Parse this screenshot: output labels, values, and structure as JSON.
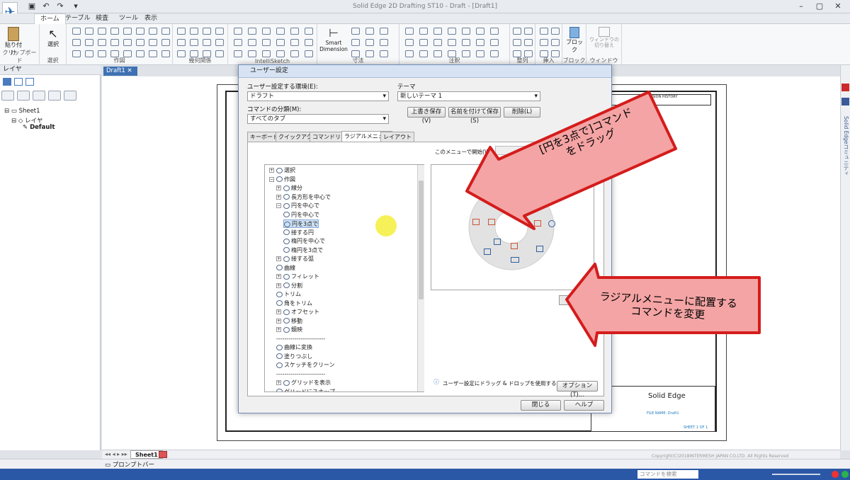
{
  "app": {
    "title": "Solid Edge 2D Drafting ST10 - Draft - [Draft1]",
    "menu_glyph": "▾",
    "tabs": [
      "ホーム",
      "テーブル",
      "検査",
      "ツール",
      "表示"
    ]
  },
  "ribbon": {
    "groups": [
      "クリップボード",
      "選択",
      "作図",
      "幾何関係",
      "IntelliSketch",
      "寸法",
      "注釈",
      "整列",
      "挿入",
      "ブロック",
      "ウィンドウ"
    ],
    "paste_label": "貼り付け",
    "select_label": "選択",
    "smart_dimension_label": "Smart Dimension",
    "block_label": "ブロック",
    "window_label": "ウィンドウの切り替え"
  },
  "left_panel": {
    "title": "レイヤ",
    "tree": [
      "Sheet1",
      "レイヤ",
      "Default"
    ]
  },
  "document": {
    "tab": "Draft1"
  },
  "sheet_tab": "Sheet1",
  "status": {
    "prompt_bar": "プロンプトバー",
    "copyright": "Copyright(C)2018INTERMESH JAPAN CO.LTD. All Rights Reserved",
    "command_search": "コマンドを検索"
  },
  "title_block": {
    "brand": "Solid Edge",
    "file_name": "FILE NAME: Draft1",
    "sheet": "SHEET 1 OF 1",
    "revision_history": "REVISION HISTORY"
  },
  "side_links": [
    "Solid Edgeコミュニティ"
  ],
  "dialog": {
    "title": "ユーザー設定",
    "env_label": "ユーザー設定する環境(E):",
    "env_value": "ドラフト",
    "theme_label": "テーマ",
    "theme_value": "新しいテーマ 1",
    "category_label": "コマンドの分類(M):",
    "category_value": "すべてのタブ",
    "overwrite_button": "上書き保存(V)",
    "saveas_button": "名前を付けて保存(S)",
    "delete_button": "削除(L)",
    "tabs": [
      "キーボード",
      "クイックアクセス",
      "コマンドリボン",
      "ラジアルメニュー",
      "レイアウト"
    ],
    "active_tab": "ラジアルメニュー",
    "start_menu_label": "このメニューで開始(W):",
    "tree_items": [
      {
        "label": "選択",
        "level": 0,
        "expand": "+"
      },
      {
        "label": "作図",
        "level": 0,
        "expand": "−"
      },
      {
        "label": "線分",
        "level": 1,
        "expand": "+"
      },
      {
        "label": "長方形を中心で",
        "level": 1,
        "expand": "+"
      },
      {
        "label": "円を中心で",
        "level": 1,
        "expand": "−"
      },
      {
        "label": "円を中心で",
        "level": 2,
        "expand": ""
      },
      {
        "label": "円を3点で",
        "level": 2,
        "expand": "",
        "selected": true
      },
      {
        "label": "接する円",
        "level": 2,
        "expand": ""
      },
      {
        "label": "楕円を中心で",
        "level": 2,
        "expand": ""
      },
      {
        "label": "楕円を3点で",
        "level": 2,
        "expand": ""
      },
      {
        "label": "接する弧",
        "level": 1,
        "expand": "+"
      },
      {
        "label": "曲線",
        "level": 1,
        "expand": ""
      },
      {
        "label": "フィレット",
        "level": 1,
        "expand": "+"
      },
      {
        "label": "分割",
        "level": 1,
        "expand": "+"
      },
      {
        "label": "トリム",
        "level": 1,
        "expand": ""
      },
      {
        "label": "角をトリム",
        "level": 1,
        "expand": ""
      },
      {
        "label": "オフセット",
        "level": 1,
        "expand": "+"
      },
      {
        "label": "移動",
        "level": 1,
        "expand": "+"
      },
      {
        "label": "鏡映",
        "level": 1,
        "expand": "+"
      },
      {
        "label": "------------------------",
        "level": 1,
        "expand": ""
      },
      {
        "label": "曲線に変換",
        "level": 1,
        "expand": ""
      },
      {
        "label": "塗りつぶし",
        "level": 1,
        "expand": ""
      },
      {
        "label": "スケッチをクリーン",
        "level": 1,
        "expand": ""
      },
      {
        "label": "------------------------",
        "level": 1,
        "expand": ""
      },
      {
        "label": "グリッドを表示",
        "level": 1,
        "expand": "+"
      },
      {
        "label": "グリッドにスナップ",
        "level": 1,
        "expand": ""
      }
    ],
    "hint": "ユーザー設定にドラッグ & ドロップを使用する",
    "options_button": "オプション(T)...",
    "close_button": "閉じる",
    "help_button": "ヘルプ"
  },
  "callouts": {
    "top_line1": "[円を3点で]コマンド",
    "top_line2": "をドラッグ",
    "bottom_line1": "ラジアルメニューに配置する",
    "bottom_line2": "コマンドを変更"
  },
  "colors": {
    "callout_fill": "#f4a4a4",
    "callout_stroke": "#d41c1c",
    "accent": "#2b57a7"
  }
}
